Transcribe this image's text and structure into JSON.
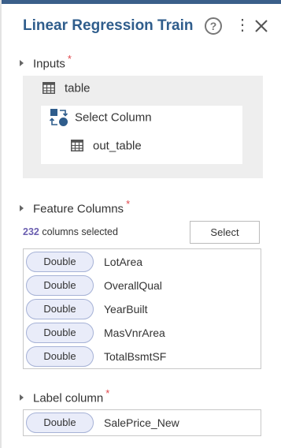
{
  "header": {
    "title": "Linear Regression Train"
  },
  "inputs": {
    "label": "Inputs",
    "required_mark": "*",
    "table_label": "table",
    "select_column_label": "Select Column",
    "output_label": "out_table"
  },
  "feature_columns": {
    "label": "Feature Columns",
    "required_mark": "*",
    "count": "232",
    "count_suffix": "columns selected",
    "select_button": "Select",
    "columns": [
      {
        "type": "Double",
        "name": "LotArea"
      },
      {
        "type": "Double",
        "name": "OverallQual"
      },
      {
        "type": "Double",
        "name": "YearBuilt"
      },
      {
        "type": "Double",
        "name": "MasVnrArea"
      },
      {
        "type": "Double",
        "name": "TotalBsmtSF"
      }
    ]
  },
  "label_column": {
    "label": "Label column",
    "required_mark": "*",
    "type": "Double",
    "name": "SalePrice_New"
  },
  "colors": {
    "title": "#2f5d8c",
    "required": "#e0474c",
    "count": "#6b5fb0",
    "pill_bg": "#e9ecf9",
    "select_column_icon": "#2f5d8c"
  }
}
